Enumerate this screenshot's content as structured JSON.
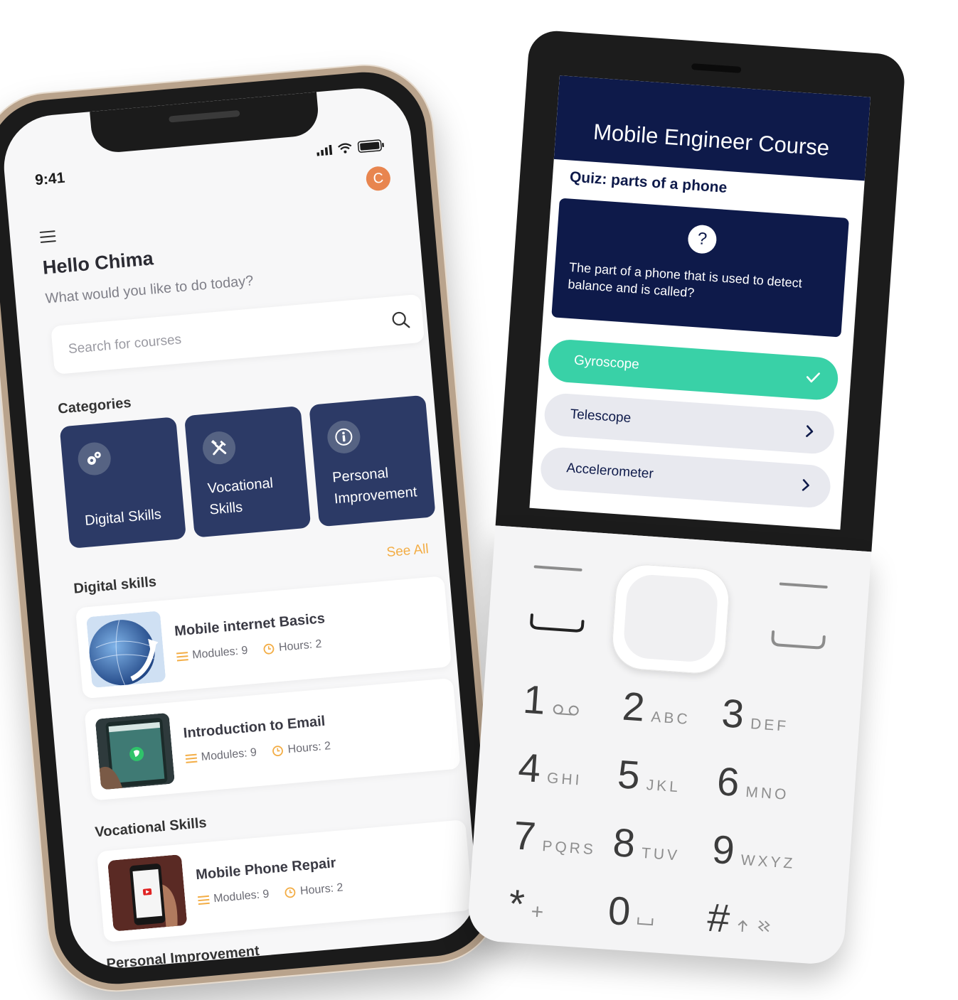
{
  "smartphone": {
    "status": {
      "time": "9:41"
    },
    "avatar_initial": "C",
    "greeting": "Hello Chima",
    "subgreeting": "What would you like to do today?",
    "search": {
      "placeholder": "Search for courses"
    },
    "categories_title": "Categories",
    "categories": [
      {
        "label": "Digital Skills",
        "icon": "gears-icon"
      },
      {
        "label": "Vocational Skills",
        "icon": "tools-icon"
      },
      {
        "label": "Personal Improvement",
        "icon": "info-icon"
      }
    ],
    "see_all": "See All",
    "sections": [
      {
        "title": "Digital skills"
      },
      {
        "title": "Vocational Skills"
      },
      {
        "title": "Personal Improvement"
      }
    ],
    "courses": [
      {
        "title": "Mobile internet Basics",
        "modules": "Modules: 9",
        "hours": "Hours: 2",
        "thumb": "globe-image"
      },
      {
        "title": "Introduction to Email",
        "modules": "Modules: 9",
        "hours": "Hours: 2",
        "thumb": "whatsapp-image"
      },
      {
        "title": "Mobile Phone Repair",
        "modules": "Modules: 9",
        "hours": "Hours: 2",
        "thumb": "phone-repair-image"
      }
    ],
    "colors": {
      "category_bg": "#2c3a66",
      "accent": "#f3ad45",
      "avatar": "#e8854f"
    }
  },
  "featurephone": {
    "app_title": "Mobile Engineer Course",
    "quiz_title": "Quiz: parts of a phone",
    "question": "The part of a phone that is used to detect balance and is called?",
    "options": [
      {
        "label": "Gyroscope",
        "state": "correct"
      },
      {
        "label": "Telescope",
        "state": "default"
      },
      {
        "label": "Accelerometer",
        "state": "default"
      }
    ],
    "keys": [
      {
        "digit": "1",
        "letters": ""
      },
      {
        "digit": "2",
        "letters": "ABC"
      },
      {
        "digit": "3",
        "letters": "DEF"
      },
      {
        "digit": "4",
        "letters": "GHI"
      },
      {
        "digit": "5",
        "letters": "JKL"
      },
      {
        "digit": "6",
        "letters": "MNO"
      },
      {
        "digit": "7",
        "letters": "PQRS"
      },
      {
        "digit": "8",
        "letters": "TUV"
      },
      {
        "digit": "9",
        "letters": "WXYZ"
      },
      {
        "digit": "*",
        "letters": "+"
      },
      {
        "digit": "0",
        "letters": ""
      },
      {
        "digit": "#",
        "letters": ""
      }
    ],
    "colors": {
      "header": "#0e1a4a",
      "correct": "#39d1a7",
      "option": "#e8e9ef"
    }
  }
}
